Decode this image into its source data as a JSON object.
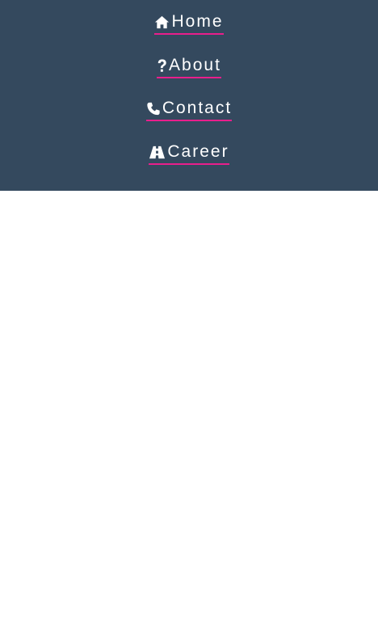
{
  "nav": {
    "background": "#34495e",
    "underline_color": "#e91e8c",
    "text_color": "#ffffff",
    "items": [
      {
        "label": "Home",
        "icon": "home-icon"
      },
      {
        "label": "About",
        "icon": "question-icon"
      },
      {
        "label": "Contact",
        "icon": "phone-icon"
      },
      {
        "label": "Career",
        "icon": "road-icon"
      }
    ]
  }
}
